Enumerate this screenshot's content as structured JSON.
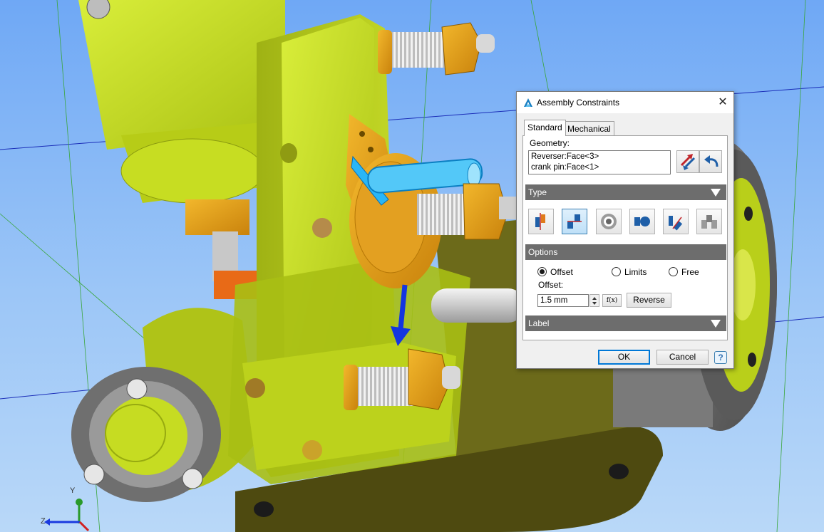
{
  "viewport": {
    "axes": {
      "y_label": "Y",
      "z_label": "Z"
    }
  },
  "dialog": {
    "title": "Assembly Constraints",
    "close_label": "✕",
    "tabs": [
      {
        "label": "Standard",
        "active": true
      },
      {
        "label": "Mechanical",
        "active": false
      }
    ],
    "geometry_label": "Geometry:",
    "geometry_items": [
      "Reverser:Face<3>",
      "crank pin:Face<1>"
    ],
    "type_section": "Type",
    "type_icons": [
      "mate-icon",
      "flush-icon",
      "concentric-icon",
      "tangent-icon",
      "angle-icon",
      "symmetry-icon"
    ],
    "selected_type_index": 1,
    "options_section": "Options",
    "radios": [
      {
        "label": "Offset",
        "checked": true
      },
      {
        "label": "Limits",
        "checked": false
      },
      {
        "label": "Free",
        "checked": false
      }
    ],
    "offset_label": "Offset:",
    "offset_value": "1.5 mm",
    "fx_label": "f(x)",
    "reverse_label": "Reverse",
    "label_section": "Label",
    "ok_label": "OK",
    "cancel_label": "Cancel",
    "help_label": "?"
  },
  "colors": {
    "part_green": "#c8e01a",
    "part_orange": "#e8a21a",
    "selection_blue": "#29b6f6",
    "section_header": "#6d6d6d"
  }
}
